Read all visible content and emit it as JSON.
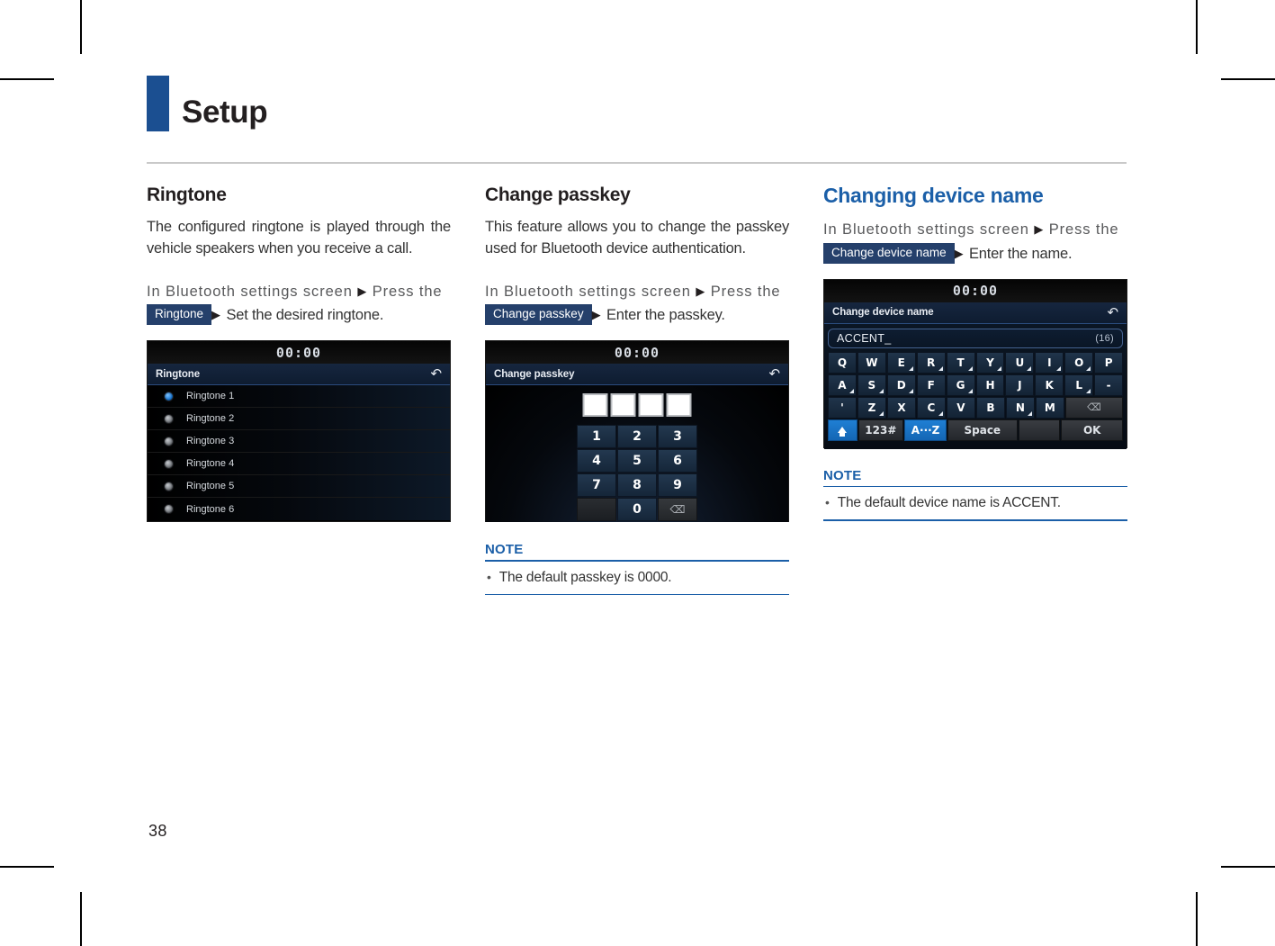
{
  "page": {
    "chapter_title": "Setup",
    "page_number": "38"
  },
  "columns": {
    "ringtone": {
      "heading": "Ringtone",
      "body": "The configured ringtone is played through the vehicle speakers when you receive a call.",
      "path_prefix": "In Bluetooth settings screen",
      "path_mid": "Press the",
      "button_label": "Ringtone",
      "path_suffix": "Set the desired ringtone.",
      "screen": {
        "clock": "00:00",
        "title": "Ringtone",
        "back_icon": "back-arrow-icon",
        "items": [
          {
            "label": "Ringtone 1",
            "selected": true
          },
          {
            "label": "Ringtone 2",
            "selected": false
          },
          {
            "label": "Ringtone 3",
            "selected": false
          },
          {
            "label": "Ringtone 4",
            "selected": false
          },
          {
            "label": "Ringtone 5",
            "selected": false
          },
          {
            "label": "Ringtone 6",
            "selected": false
          }
        ]
      }
    },
    "passkey": {
      "heading": "Change passkey",
      "body": "This feature allows you to change the passkey used for Bluetooth device authentication.",
      "path_prefix": "In Bluetooth settings screen",
      "path_mid": "Press the",
      "button_label": "Change passkey",
      "path_suffix": "Enter the passkey.",
      "screen": {
        "clock": "00:00",
        "title": "Change passkey",
        "back_icon": "back-arrow-icon",
        "digit_boxes": [
          "",
          "",
          "",
          ""
        ],
        "keys": [
          "1",
          "2",
          "3",
          "4",
          "5",
          "6",
          "7",
          "8",
          "9",
          "",
          "0",
          "delete-icon"
        ]
      },
      "note": {
        "title": "NOTE",
        "items": [
          "The default passkey is 0000."
        ]
      }
    },
    "device_name": {
      "heading": "Changing device name",
      "path_prefix": "In Bluetooth settings screen",
      "path_mid": "Press the",
      "button_label": "Change device name",
      "path_suffix": "Enter the name.",
      "screen": {
        "clock": "00:00",
        "title": "Change device name",
        "back_icon": "back-arrow-icon",
        "input_value": "ACCENT_",
        "char_count": "(16)",
        "row1": [
          "Q",
          "W",
          "E",
          "R",
          "T",
          "Y",
          "U",
          "I",
          "O",
          "P"
        ],
        "row1_sub": [
          false,
          false,
          true,
          true,
          true,
          true,
          true,
          true,
          true,
          false
        ],
        "row2": [
          "A",
          "S",
          "D",
          "F",
          "G",
          "H",
          "J",
          "K",
          "L",
          "-"
        ],
        "row2_sub": [
          true,
          true,
          true,
          false,
          true,
          false,
          false,
          false,
          true,
          false
        ],
        "row3": [
          "'",
          "Z",
          "X",
          "C",
          "V",
          "B",
          "N",
          "M"
        ],
        "row3_sub": [
          false,
          true,
          false,
          true,
          false,
          false,
          true,
          false
        ],
        "delete_label": "delete-icon",
        "bottom": {
          "shift": "shift-icon",
          "numbers": "123#",
          "alpha": "A···Z",
          "space": "Space",
          "blank": "",
          "ok": "OK"
        }
      },
      "note": {
        "title": "NOTE",
        "items": [
          "The default device name is ACCENT."
        ]
      }
    }
  },
  "colors": {
    "brand_blue": "#1b4f91",
    "heading_blue": "#1b5fa8",
    "inline_button": "#25406b",
    "accent_key": "#1f7fd4"
  }
}
